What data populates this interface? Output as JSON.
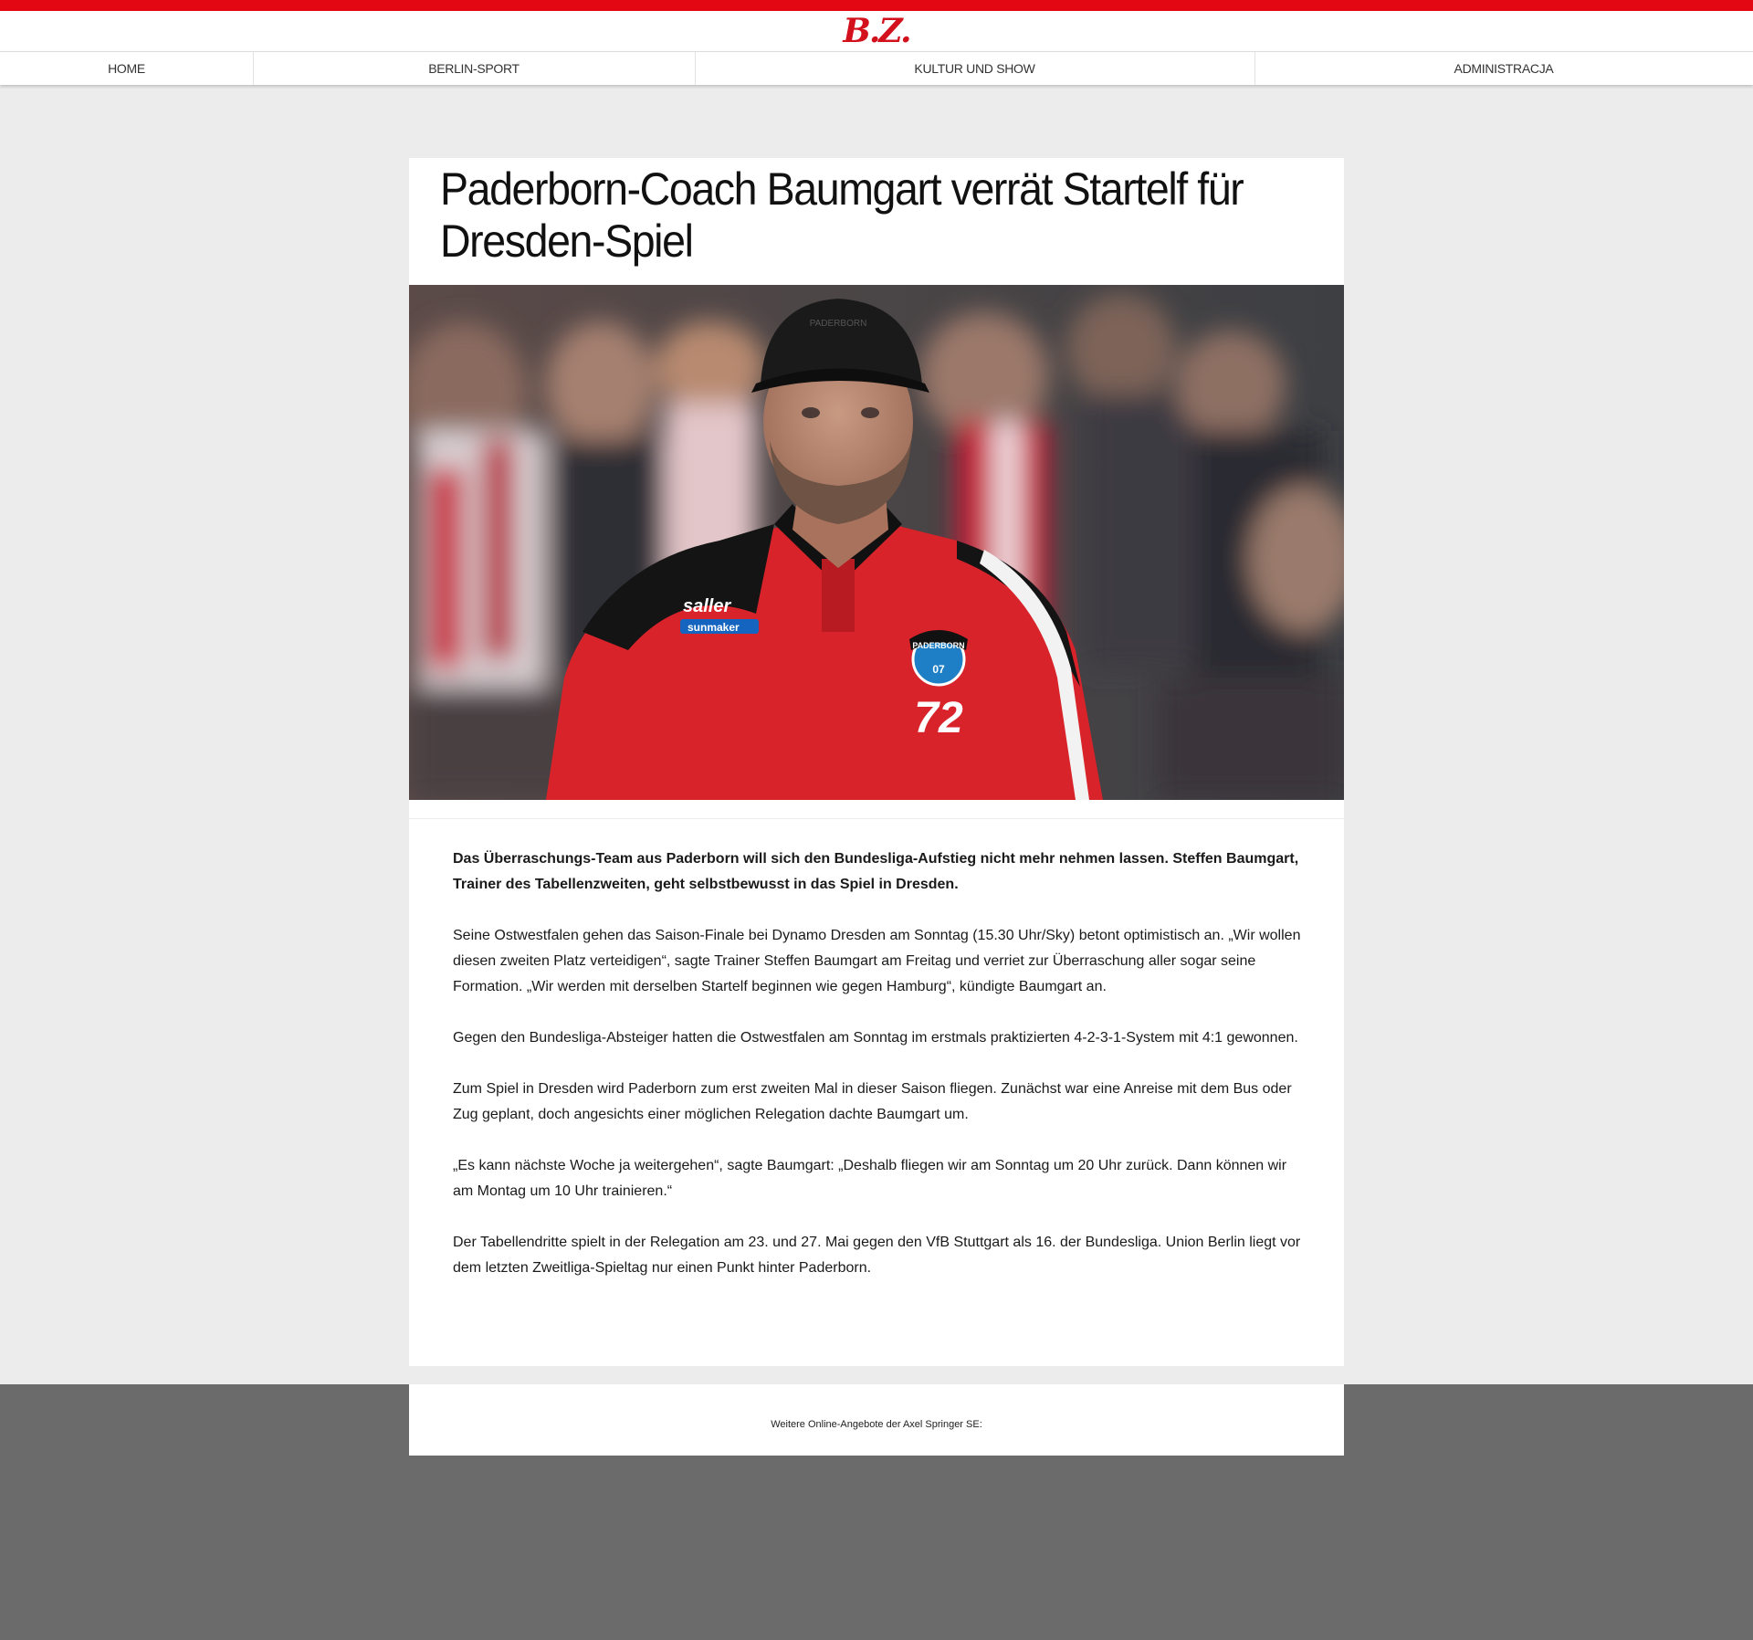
{
  "header": {
    "logo_text": "B.Z.",
    "accent_color": "#e30613"
  },
  "nav": {
    "items": [
      {
        "label": "HOME"
      },
      {
        "label": "BERLIN-SPORT"
      },
      {
        "label": "KULTUR UND SHOW"
      },
      {
        "label": "ADMINISTRACJA"
      }
    ]
  },
  "article": {
    "headline": "Paderborn-Coach Baumgart verrät Startelf für Dresden-Spiel",
    "image": {
      "cap_text": "PADERBORN",
      "shirt_sponsor_1": "saller",
      "shirt_sponsor_2": "sunmaker",
      "badge_text": "PADERBORN",
      "badge_number": "07",
      "shirt_number": "72"
    },
    "lead": "Das Überraschungs-Team aus Paderborn will sich den Bundesliga-Aufstieg nicht mehr nehmen lassen. Steffen Baumgart, Trainer des Tabellenzweiten, geht selbstbewusst in das Spiel in Dresden.",
    "paragraphs": [
      "Seine Ostwestfalen gehen das Saison-Finale bei Dynamo Dresden am Sonntag (15.30 Uhr/Sky) betont optimistisch an. „Wir wollen diesen zweiten Platz verteidigen“, sagte Trainer Steffen Baumgart am Freitag und verriet zur Überraschung aller sogar seine Formation. „Wir werden mit derselben Startelf beginnen wie gegen Hamburg“, kündigte Baumgart an.",
      "Gegen den Bundesliga-Absteiger hatten die Ostwestfalen am Sonntag im erstmals praktizierten 4-2-3-1-System mit 4:1 gewonnen.",
      "Zum Spiel in Dresden wird Paderborn zum erst zweiten Mal in dieser Saison fliegen. Zunächst war eine Anreise mit dem Bus oder Zug geplant, doch angesichts einer möglichen Relegation dachte Baumgart um.",
      "„Es kann nächste Woche ja weitergehen“, sagte Baumgart: „Deshalb fliegen wir am Sonntag um 20 Uhr zurück. Dann können wir am Montag um 10 Uhr trainieren.“",
      "Der Tabellendritte spielt in der Relegation am 23. und 27. Mai gegen den VfB Stuttgart als 16. der Bundesliga. Union Berlin liegt vor dem letzten Zweitliga-Spieltag nur einen Punkt hinter Paderborn."
    ]
  },
  "footer": {
    "text": "Weitere Online-Angebote der Axel Springer SE:"
  }
}
